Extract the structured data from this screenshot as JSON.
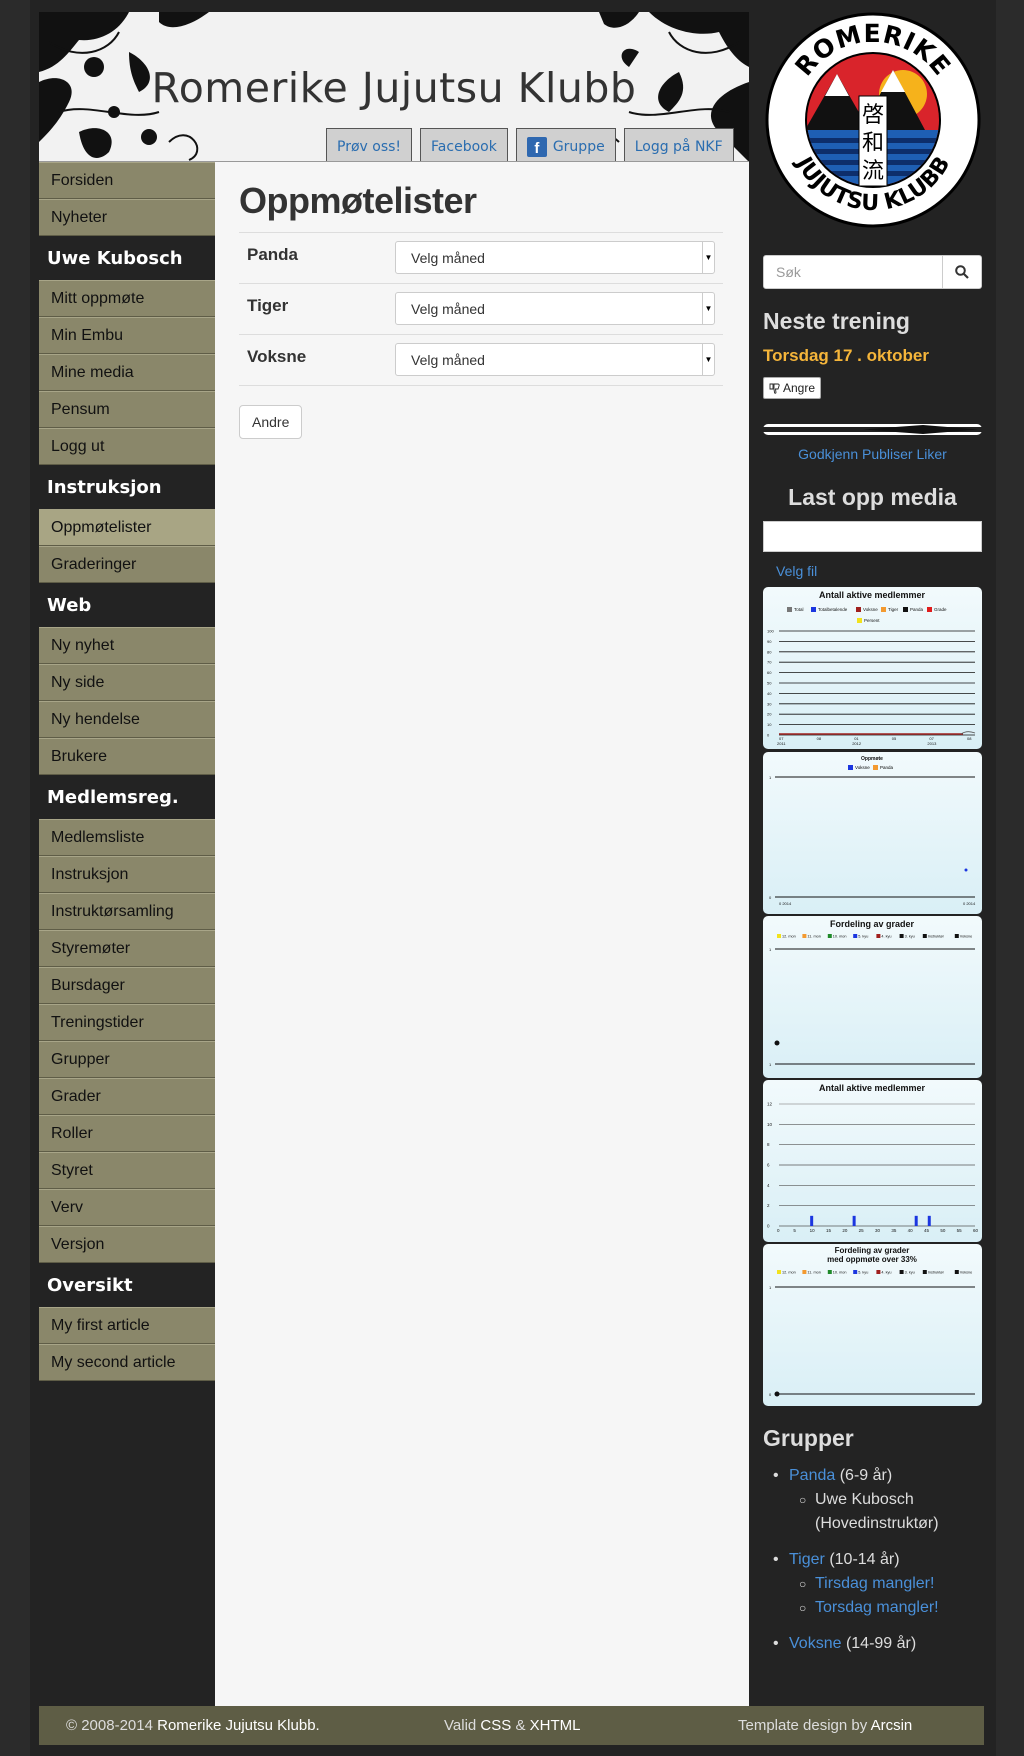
{
  "header": {
    "title": "Romerike Jujutsu Klubb",
    "buttons": [
      "Prøv oss!",
      "Facebook",
      "Gruppe",
      "Logg på NKF"
    ],
    "fb_icon": "f"
  },
  "nav": {
    "top": [
      "Forsiden",
      "Nyheter"
    ],
    "user_heading": "Uwe Kubosch",
    "user_items": [
      "Mitt oppmøte",
      "Min Embu",
      "Mine media",
      "Pensum",
      "Logg ut"
    ],
    "instr_heading": "Instruksjon",
    "instr_items": [
      "Oppmøtelister",
      "Graderinger"
    ],
    "web_heading": "Web",
    "web_items": [
      "Ny nyhet",
      "Ny side",
      "Ny hendelse",
      "Brukere"
    ],
    "mem_heading": "Medlemsreg.",
    "mem_items": [
      "Medlemsliste",
      "Instruksjon",
      "Instruktørsamling",
      "Styremøter",
      "Bursdager",
      "Treningstider",
      "Grupper",
      "Grader",
      "Roller",
      "Styret",
      "Verv",
      "Versjon"
    ],
    "over_heading": "Oversikt",
    "over_items": [
      "My first article",
      "My second article"
    ]
  },
  "main": {
    "title": "Oppmøtelister",
    "rows": [
      {
        "label": "Panda",
        "select": "Velg måned"
      },
      {
        "label": "Tiger",
        "select": "Velg måned"
      },
      {
        "label": "Voksne",
        "select": "Velg måned"
      }
    ],
    "other_button": "Andre"
  },
  "sidebar": {
    "logo_top": "ROMERIKE",
    "logo_bottom": "JUJUTSU KLUBB",
    "logo_kanji": [
      "啓",
      "和",
      "流"
    ],
    "search_placeholder": "Søk",
    "next_title": "Neste trening",
    "next_date": "Torsdag 17 . oktober",
    "undo_label": "Angre",
    "approve_links": "Godkjenn Publiser Liker",
    "upload_title": "Last opp media",
    "choose_file": "Velg fil",
    "groups_title": "Grupper",
    "groups": {
      "panda": {
        "name": "Panda",
        "ages": "(6-9 år)",
        "members": [
          "Uwe Kubosch",
          "(Hovedinstruktør)"
        ]
      },
      "tiger": {
        "name": "Tiger",
        "ages": "(10-14 år)",
        "missing": [
          "Tirsdag mangler!",
          "Torsdag mangler!"
        ]
      },
      "voksne": {
        "name": "Voksne",
        "ages": "(14-99 år)"
      }
    }
  },
  "chart_data": [
    {
      "type": "line",
      "title": "Antall aktive medlemmer",
      "series": [
        {
          "name": "Total"
        },
        {
          "name": "Totalbetalende"
        },
        {
          "name": "Voksne"
        },
        {
          "name": "Tiger"
        },
        {
          "name": "Panda"
        },
        {
          "name": "Grade"
        },
        {
          "name": "Persent"
        }
      ],
      "ylim": [
        0,
        100
      ],
      "yticks": [
        "100",
        "90",
        "80",
        "70",
        "60",
        "50",
        "40",
        "30",
        "20",
        "10",
        "0"
      ],
      "xticks": [
        "07 2011",
        "08",
        "01 2012",
        "05",
        "07 2013",
        "08"
      ]
    },
    {
      "type": "scatter",
      "title": "Oppmøte",
      "series": [
        {
          "name": "Voksne"
        },
        {
          "name": "Panda"
        }
      ],
      "yticks": [
        "1",
        "0"
      ],
      "xticks": [
        "0 2014",
        "0 2014"
      ]
    },
    {
      "type": "scatter",
      "title": "Fordeling av grader",
      "series": [
        {
          "name": "12. mon"
        },
        {
          "name": "11. mon"
        },
        {
          "name": "10. mon"
        },
        {
          "name": "5. kyu"
        },
        {
          "name": "4. kyu"
        },
        {
          "name": "3. kyu"
        },
        {
          "name": "Instruktør"
        },
        {
          "name": "Voksne"
        }
      ],
      "yticks": [
        "1",
        "1"
      ]
    },
    {
      "type": "bar",
      "title": "Antall aktive medlemmer",
      "x": [
        10,
        23,
        42,
        46
      ],
      "values": [
        1,
        1,
        1,
        1
      ],
      "xticks": [
        "0",
        "5",
        "10",
        "15",
        "20",
        "25",
        "30",
        "35",
        "40",
        "45",
        "50",
        "55",
        "60"
      ],
      "yticks": [
        "12",
        "10",
        "8",
        "6",
        "4",
        "2",
        "0"
      ],
      "ylim": [
        0,
        12
      ]
    },
    {
      "type": "scatter",
      "title": "Fordeling av grader\nmed oppmøte over 33%",
      "series": [
        {
          "name": "12. mon"
        },
        {
          "name": "11. mon"
        },
        {
          "name": "10. mon"
        },
        {
          "name": "5. kyu"
        },
        {
          "name": "4. kyu"
        },
        {
          "name": "3. kyu"
        },
        {
          "name": "Instruktør"
        },
        {
          "name": "Voksne"
        }
      ],
      "yticks": [
        "1",
        "0"
      ]
    }
  ],
  "footer": {
    "copyright": "© 2008-2014",
    "club": "Romerike Jujutsu Klubb.",
    "valid_prefix": "Valid",
    "css": "CSS",
    "amp": "&",
    "xhtml": "XHTML",
    "design_prefix": "Template design by",
    "designer": "Arcsin"
  },
  "colors": {
    "nav_bg": "#8a876a",
    "accent_orange": "#f5b53a",
    "link_blue": "#4a90d9",
    "footer_bg": "#5e5d45"
  }
}
